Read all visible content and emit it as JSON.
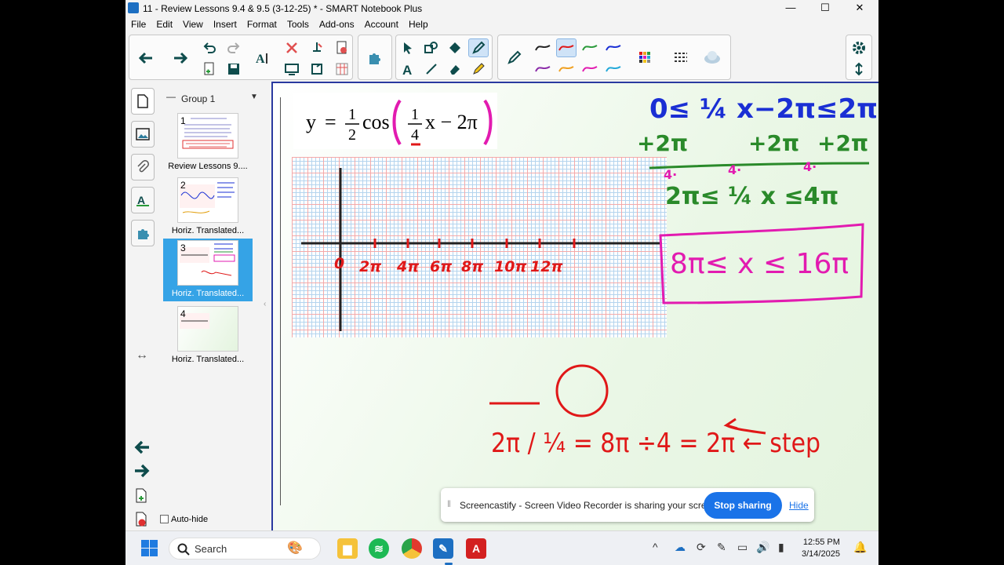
{
  "window": {
    "title": "11 - Review Lessons 9.4 & 9.5 (3-12-25) * - SMART Notebook Plus",
    "controls": {
      "minimize": "—",
      "maximize": "☐",
      "close": "✕"
    }
  },
  "menu": [
    "File",
    "Edit",
    "View",
    "Insert",
    "Format",
    "Tools",
    "Add-ons",
    "Account",
    "Help"
  ],
  "toolbar": {
    "icons": [
      "back-arrow-icon",
      "forward-arrow-icon",
      "undo-icon",
      "redo-icon",
      "add-page-icon",
      "save-icon",
      "text-format-icon",
      "delete-icon",
      "screen-shade-icon",
      "table-icon",
      "addons-puzzle-icon",
      "select-icon",
      "shapes-icon",
      "fill-icon",
      "pen-icon",
      "text-icon",
      "line-icon",
      "eraser-icon",
      "highlighter-icon",
      "settings-gear-icon",
      "expand-icon"
    ]
  },
  "sorter": {
    "group_label": "Group 1",
    "pages": [
      {
        "num": "1",
        "label": "Review Lessons 9...."
      },
      {
        "num": "2",
        "label": "Horiz. Translated..."
      },
      {
        "num": "3",
        "label": "Horiz. Translated...",
        "selected": true
      },
      {
        "num": "4",
        "label": "Horiz. Translated..."
      }
    ],
    "autohide_label": "Auto-hide"
  },
  "canvas": {
    "formula": {
      "y": "y",
      "eq": "=",
      "n1": "1",
      "d1": "2",
      "cos": "cos",
      "n2": "1",
      "d2": "4",
      "tail": "x − 2π"
    },
    "axis_labels": [
      "0",
      "2π",
      "4π",
      "6π",
      "8π",
      "10π",
      "12π"
    ],
    "work": {
      "line1": "0≤ ¼ x−2π≤2π",
      "plus": [
        "+2π",
        "+2π",
        "+2π"
      ],
      "times4": [
        "4·",
        "4·",
        "4·"
      ],
      "line3": "2π≤ ¼ x ≤4π",
      "boxed": "8π≤ x ≤ 16π",
      "period": "2π / ¼ = 8π ÷4 = 2π ← step"
    },
    "colors": {
      "blue": "#1a2fd4",
      "green": "#2a8a2a",
      "magenta": "#e21bb0",
      "red": "#e01818"
    }
  },
  "share_banner": {
    "message": "Screencastify - Screen Video Recorder is sharing your screen.",
    "stop_label": "Stop sharing",
    "hide_label": "Hide"
  },
  "taskbar": {
    "search_label": "Search",
    "time": "12:55 PM",
    "date": "3/14/2025"
  }
}
